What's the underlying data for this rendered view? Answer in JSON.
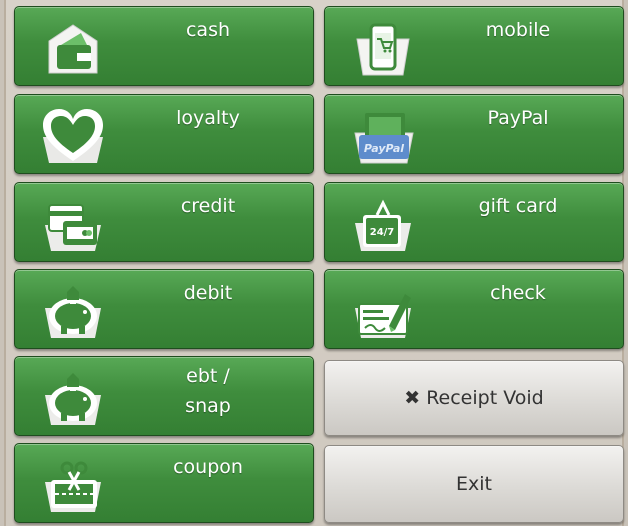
{
  "buttons": {
    "cash": "cash",
    "mobile": "mobile",
    "loyalty": "loyalty",
    "paypal": "PayPal",
    "paypal_logo_text": "PayPal",
    "credit": "credit",
    "gift_card": "gift card",
    "gift_card_badge": "24/7",
    "debit": "debit",
    "check": "check",
    "ebt_line1": "ebt /",
    "ebt_line2": "snap",
    "receipt_void": "Receipt Void",
    "coupon": "coupon",
    "exit": "Exit"
  },
  "colors": {
    "green_button": "#3f8d3d",
    "gray_button": "#dcdad6",
    "background": "#d8d2c9"
  },
  "icons": [
    "wallet-icon",
    "phone-cart-icon",
    "heart-icon",
    "paypal-icon",
    "credit-card-icon",
    "gift-card-icon",
    "piggy-bank-icon",
    "check-signature-icon",
    "piggy-bank-icon",
    "scissors-coupon-icon",
    "close-x-icon"
  ]
}
